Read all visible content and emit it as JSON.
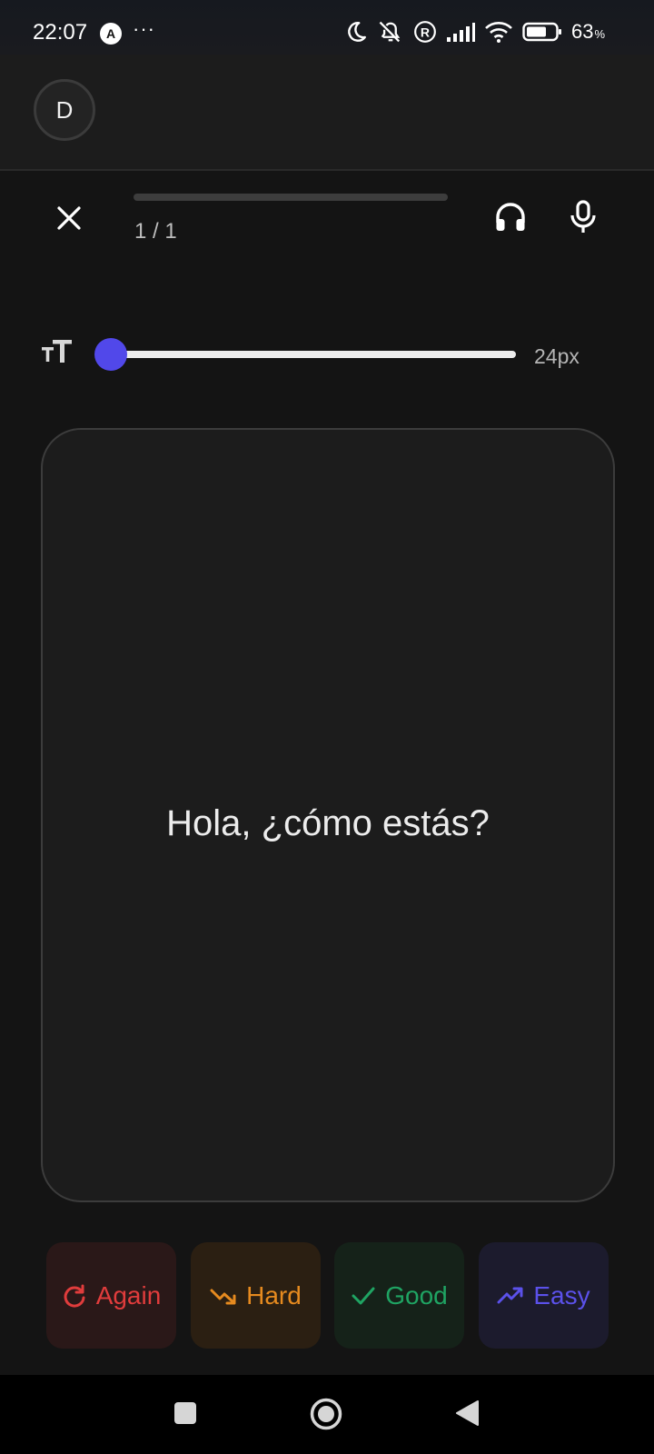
{
  "status_bar": {
    "time": "22:07",
    "app_badge": "A",
    "overflow": "···",
    "battery_percent": "63",
    "percent_sign": "%",
    "icons": [
      "moon-icon",
      "bell-off-icon",
      "registered-icon",
      "signal-icon",
      "wifi-icon",
      "battery-icon"
    ]
  },
  "header": {
    "avatar_initial": "D"
  },
  "toolbar": {
    "progress_fraction": 0,
    "progress_text": "1 / 1",
    "icons": [
      "close-icon",
      "headphones-icon",
      "microphone-icon"
    ]
  },
  "font_size": {
    "icon": "text-size-icon",
    "value_label": "24px",
    "slider_fraction": 0
  },
  "card": {
    "text": "Hola, ¿cómo estás?"
  },
  "rating_buttons": [
    {
      "label": "Again",
      "icon": "retry-icon",
      "color": "#e03c3c"
    },
    {
      "label": "Hard",
      "icon": "trending-down-icon",
      "color": "#e68a1f"
    },
    {
      "label": "Good",
      "icon": "check-icon",
      "color": "#1fa463"
    },
    {
      "label": "Easy",
      "icon": "trending-up-icon",
      "color": "#5b51ea"
    }
  ],
  "colors": {
    "accent": "#5148ea",
    "background": "#141414",
    "card": "#1c1c1c"
  },
  "nav_bar": {
    "icons": [
      "recent-apps-icon",
      "home-icon",
      "back-icon"
    ]
  }
}
